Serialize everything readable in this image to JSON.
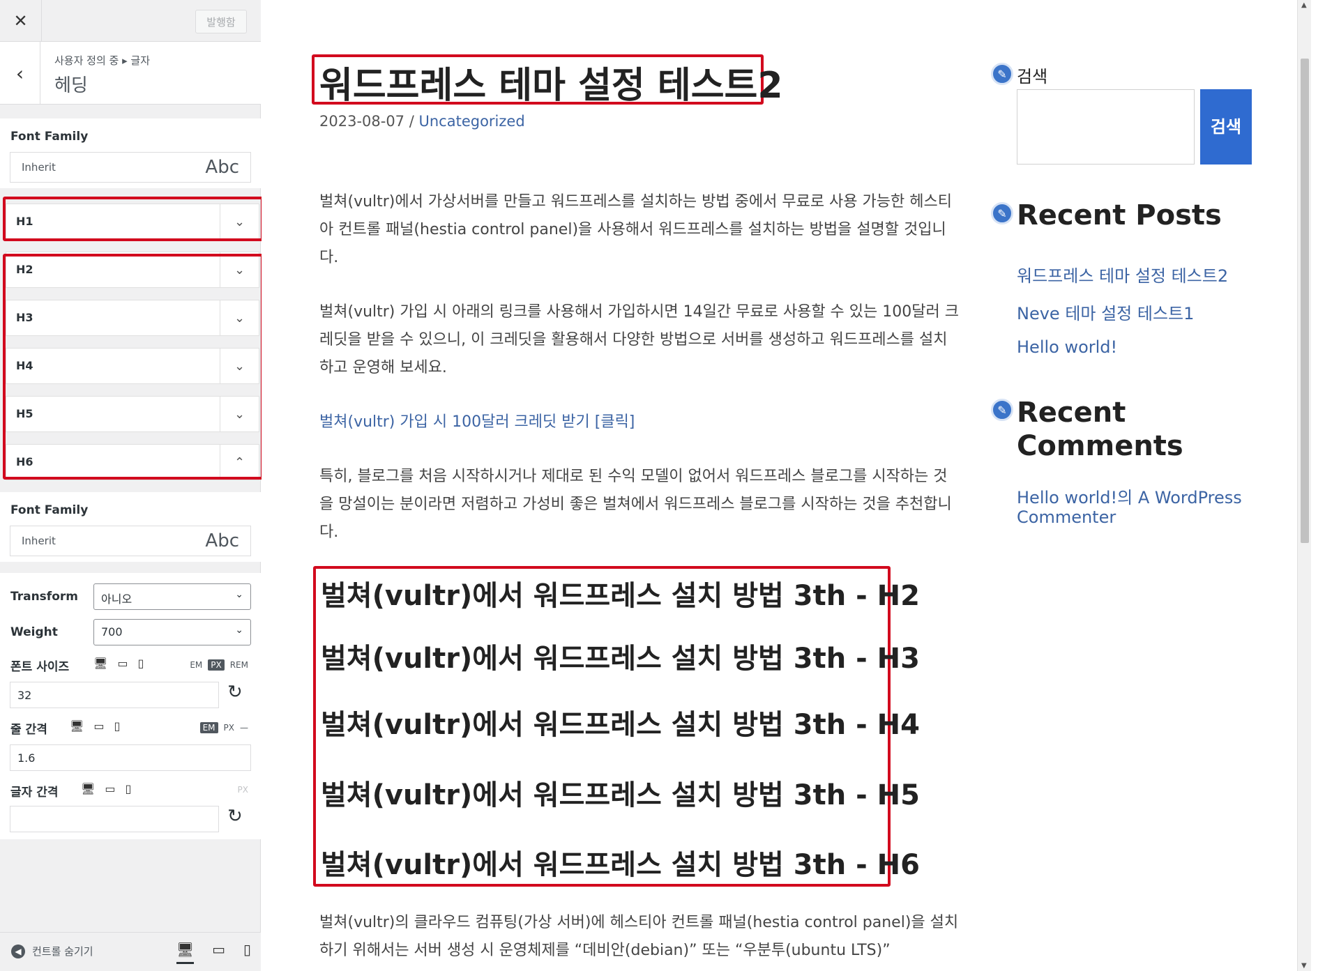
{
  "sidebar": {
    "publish_label": "발행함",
    "breadcrumb": "사용자 정의 중 ▸ 글자",
    "section_title": "헤딩",
    "font_family_label": "Font Family",
    "font_family_value": "Inherit",
    "font_preview": "Abc",
    "headings": [
      "H1",
      "H2",
      "H3",
      "H4",
      "H5",
      "H6"
    ],
    "font_family_label_2": "Font Family",
    "font_family_value_2": "Inherit",
    "font_preview_2": "Abc",
    "transform_label": "Transform",
    "transform_value": "아니오",
    "weight_label": "Weight",
    "weight_value": "700",
    "font_size_label": "폰트 사이즈",
    "font_size_units": [
      "EM",
      "PX",
      "REM"
    ],
    "font_size_value": "32",
    "line_height_label": "줄 간격",
    "line_height_units": [
      "EM",
      "PX",
      "—"
    ],
    "line_height_value": "1.6",
    "letter_spacing_label": "글자 간격",
    "letter_spacing_unit": "PX",
    "letter_spacing_value": "",
    "hide_controls_label": "컨트롤 숨기기"
  },
  "post": {
    "title": "워드프레스 테마 설정 테스트2",
    "date": "2023-08-07",
    "separator": "/",
    "category": "Uncategorized",
    "p1": "벌쳐(vultr)에서 가상서버를 만들고 워드프레스를 설치하는 방법 중에서 무료로 사용 가능한 헤스티아 컨트롤 패널(hestia control panel)을 사용해서 워드프레스를 설치하는 방법을 설명할 것입니다.",
    "p2": "벌쳐(vultr) 가입 시 아래의 링크를 사용해서 가입하시면 14일간 무료로 사용할 수 있는 100달러 크레딧을 받을 수 있으니, 이 크레딧을 활용해서 다양한 방법으로 서버를 생성하고 워드프레스를 설치하고 운영해 보세요.",
    "p3_link": "벌쳐(vultr) 가입 시 100달러 크레딧 받기 [클릭]",
    "p4": "특히, 블로그를 처음 시작하시거나 제대로 된 수익 모델이 없어서 워드프레스 블로그를 시작하는 것을 망설이는 분이라면 저렴하고 가성비 좋은 벌쳐에서 워드프레스 블로그를 시작하는 것을 추천합니다.",
    "h2": "벌쳐(vultr)에서 워드프레스 설치 방법 3th - H2",
    "h3": "벌쳐(vultr)에서 워드프레스 설치 방법 3th - H3",
    "h4": "벌쳐(vultr)에서 워드프레스 설치 방법 3th - H4",
    "h5": "벌쳐(vultr)에서 워드프레스 설치 방법 3th - H5",
    "h6": "벌쳐(vultr)에서 워드프레스 설치 방법 3th - H6",
    "p5": "벌쳐(vultr)의 클라우드 컴퓨팅(가상 서버)에 헤스티아 컨트롤 패널(hestia control panel)을 설치하기 위해서는 서버 생성 시 운영체제를 “데비안(debian)” 또는 “우분투(ubuntu LTS)”"
  },
  "widgets": {
    "search_title": "검색",
    "search_button": "검색",
    "recent_posts_title": "Recent Posts",
    "recent_posts": [
      "워드프레스 테마 설정 테스트2",
      "Neve 테마 설정 테스트1",
      "Hello world!"
    ],
    "recent_comments_title": "Recent Comments",
    "recent_comment": "Hello world!의 A WordPress Commenter"
  },
  "colors": {
    "highlight": "#d20a1e",
    "link": "#3c64a4",
    "button": "#2f6bd0"
  },
  "icons": [
    "close-icon",
    "back-icon",
    "chevron-down-icon",
    "chevron-up-icon",
    "desktop-icon",
    "tablet-icon",
    "mobile-icon",
    "reset-icon",
    "pencil-icon"
  ]
}
